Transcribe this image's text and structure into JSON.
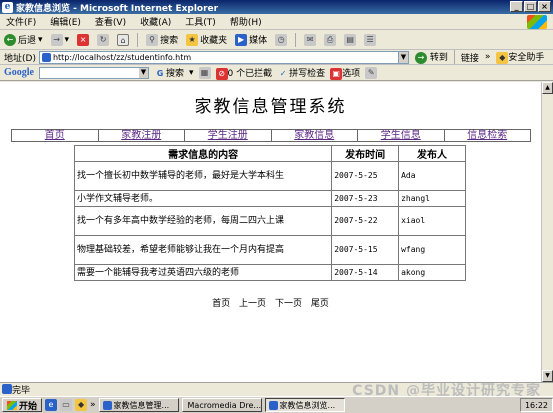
{
  "window": {
    "title": "家教信息浏览 - Microsoft Internet Explorer",
    "buttons": {
      "minimize": "_",
      "maximize": "□",
      "close": "×"
    }
  },
  "menu": [
    "文件(F)",
    "编辑(E)",
    "查看(V)",
    "收藏(A)",
    "工具(T)",
    "帮助(H)"
  ],
  "toolbar": {
    "back": "后退",
    "search": "搜索",
    "favorites": "收藏夹",
    "media": "媒体"
  },
  "address": {
    "label": "地址(D)",
    "url": "http://localhost/zz/studentinfo.htm",
    "go": "转到",
    "links": "链接",
    "security": "安全助手"
  },
  "google": {
    "logo": "Google",
    "search": "搜索",
    "blocked": "0 个已拦截",
    "spellcheck": "拼写检查",
    "options": "选项"
  },
  "page": {
    "title": "家教信息管理系统",
    "nav": [
      "首页",
      "家教注册",
      "学生注册",
      "家教信息",
      "学生信息",
      "信息检索"
    ],
    "table": {
      "headers": [
        "需求信息的内容",
        "发布时间",
        "发布人"
      ],
      "rows": [
        {
          "content": "找一个擅长初中数学辅导的老师，最好是大学本科生",
          "date": "2007-5-25",
          "publisher": "Ada"
        },
        {
          "content": "小学作文辅导老师。",
          "date": "2007-5-23",
          "publisher": "zhangl"
        },
        {
          "content": "找一个有多年高中数学经验的老师，每周二四六上课",
          "date": "2007-5-22",
          "publisher": "xiaol"
        },
        {
          "content": "物理基础较差，希望老师能够让我在一个月内有提高",
          "date": "2007-5-15",
          "publisher": "wfang"
        },
        {
          "content": "需要一个能辅导我考过英语四六级的老师",
          "date": "2007-5-14",
          "publisher": "akong"
        }
      ]
    },
    "pager": [
      "首页",
      "上一页",
      "下一页",
      "尾页"
    ]
  },
  "status": {
    "text": "完毕",
    "watermark": "CSDN @毕业设计研究专家"
  },
  "taskbar": {
    "start": "开始",
    "tasks": [
      "家教信息管理...",
      "Macromedia Dre...",
      "家教信息浏览..."
    ],
    "clock": "16:22"
  }
}
